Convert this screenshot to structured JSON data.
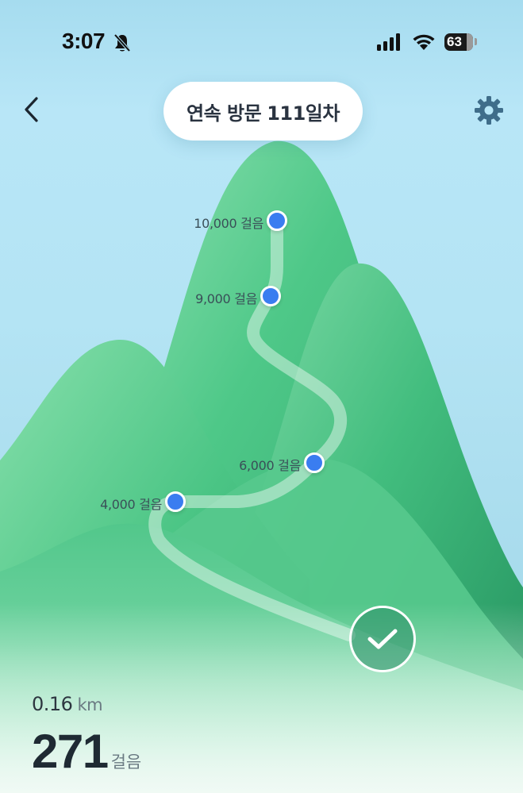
{
  "status_bar": {
    "time": "3:07",
    "battery": "63"
  },
  "header": {
    "title_prefix": "연속 방문",
    "title_count": "111일차"
  },
  "milestones": [
    {
      "label": "10,000 걸음"
    },
    {
      "label": "9,000 걸음"
    },
    {
      "label": "6,000 걸음"
    },
    {
      "label": "4,000 걸음"
    }
  ],
  "stats": {
    "distance_value": "0.16",
    "distance_unit": "km",
    "steps_value": "271",
    "steps_unit": "걸음"
  },
  "colors": {
    "sky": "#b8e6f7",
    "mountain": "#4cc485",
    "dot": "#3a7df0"
  },
  "icons": {
    "back": "chevron-left-icon",
    "settings": "gear-icon",
    "check": "checkmark-icon",
    "mute": "bell-slash-icon",
    "signal": "signal-icon",
    "wifi": "wifi-icon",
    "battery": "battery-icon"
  }
}
